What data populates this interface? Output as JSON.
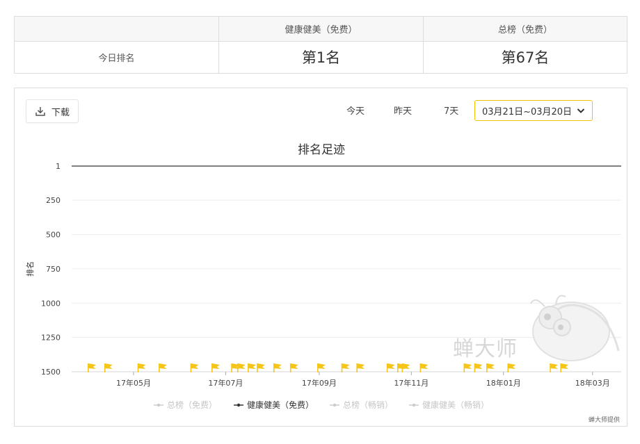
{
  "rank_table": {
    "headers": [
      "",
      "健康健美（免费）",
      "总榜（免费）"
    ],
    "row_label": "今日排名",
    "values": [
      "第1名",
      "第67名"
    ]
  },
  "toolbar": {
    "download_label": "下载",
    "ranges": [
      "今天",
      "昨天",
      "7天"
    ],
    "date_range": "03月21日~03月20日"
  },
  "watermark_text": "蝉大师",
  "provider_text": "蝉大师提供",
  "chart_data": {
    "type": "line",
    "title": "排名足迹",
    "ylabel": "排名",
    "y_inverted": true,
    "ylim": [
      1,
      1500
    ],
    "yticks": [
      1,
      250,
      500,
      750,
      1000,
      1250,
      1500
    ],
    "xlim": [
      "2017-03-21",
      "2018-03-20"
    ],
    "xticks": [
      {
        "label": "17年05月",
        "date": "2017-05-01"
      },
      {
        "label": "17年07月",
        "date": "2017-07-01"
      },
      {
        "label": "17年09月",
        "date": "2017-09-01"
      },
      {
        "label": "17年11月",
        "date": "2017-11-01"
      },
      {
        "label": "18年01月",
        "date": "2018-01-01"
      },
      {
        "label": "18年03月",
        "date": "2018-03-01"
      }
    ],
    "grid": true,
    "legend_position": "bottom",
    "series": [
      {
        "name": "总榜（免费）",
        "active": false,
        "color": "#cccccc",
        "values": []
      },
      {
        "name": "健康健美（免费）",
        "active": true,
        "color": "#333333",
        "values": [
          {
            "x": "2017-03-21",
            "y": 1
          },
          {
            "x": "2018-03-20",
            "y": 1
          }
        ]
      },
      {
        "name": "总榜（畅销）",
        "active": false,
        "color": "#cccccc",
        "values": []
      },
      {
        "name": "健康健美（畅销）",
        "active": false,
        "color": "#cccccc",
        "values": []
      }
    ],
    "flag_color": "#f5c518",
    "flags": [
      "2017-04-01",
      "2017-04-12",
      "2017-05-04",
      "2017-05-18",
      "2017-06-08",
      "2017-06-22",
      "2017-07-05",
      "2017-07-09",
      "2017-07-16",
      "2017-07-22",
      "2017-08-02",
      "2017-08-13",
      "2017-08-31",
      "2017-09-16",
      "2017-09-26",
      "2017-10-16",
      "2017-10-23",
      "2017-10-26",
      "2017-11-07",
      "2017-12-06",
      "2017-12-13",
      "2017-12-21",
      "2018-01-04",
      "2018-02-01",
      "2018-02-08"
    ]
  }
}
